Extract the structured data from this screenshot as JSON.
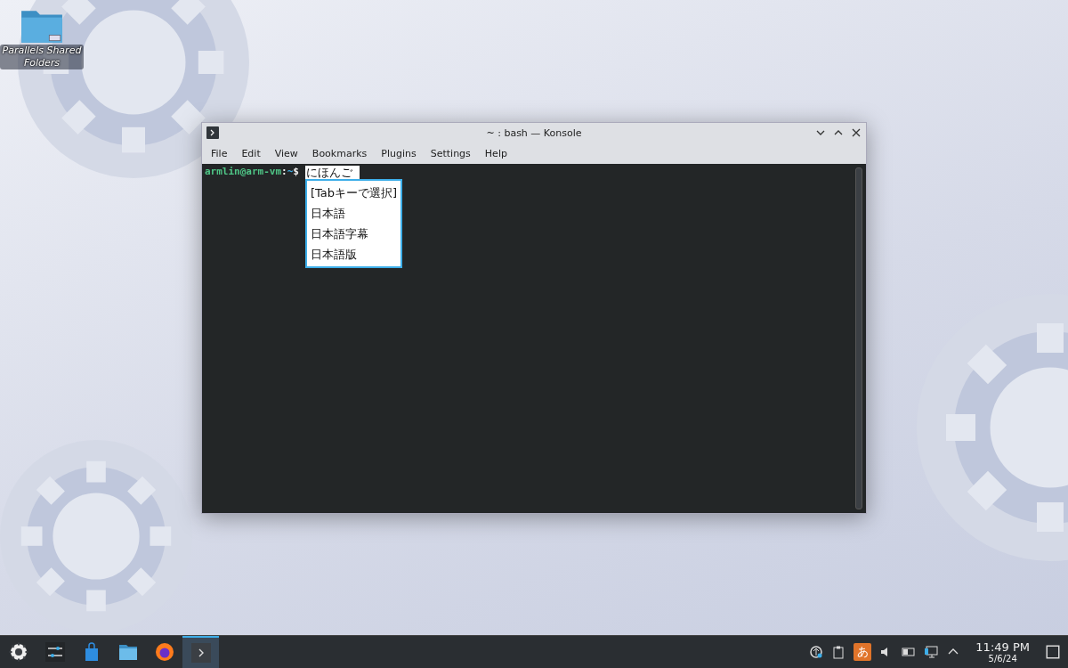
{
  "desktop_icons": [
    {
      "label": "Parallels Shared Folders"
    }
  ],
  "window": {
    "title": "~ : bash — Konsole",
    "menu": [
      "File",
      "Edit",
      "View",
      "Bookmarks",
      "Plugins",
      "Settings",
      "Help"
    ],
    "terminal": {
      "user_host": "armlin@arm-vm",
      "separator": ":",
      "path": "~",
      "symbol": "$",
      "preedit": "にほんご",
      "candidates": [
        "[Tabキーで選択]",
        "日本語",
        "日本語字幕",
        "日本語版"
      ]
    }
  },
  "taskbar": {
    "tasks": [
      {
        "kind": "launcher",
        "selected": false
      },
      {
        "kind": "settings",
        "selected": false
      },
      {
        "kind": "store",
        "selected": false
      },
      {
        "kind": "files",
        "selected": false
      },
      {
        "kind": "browser",
        "selected": false
      },
      {
        "kind": "terminal",
        "selected": true
      }
    ],
    "input_method": "あ",
    "time": "11:49 PM",
    "date": "5/6/24"
  }
}
